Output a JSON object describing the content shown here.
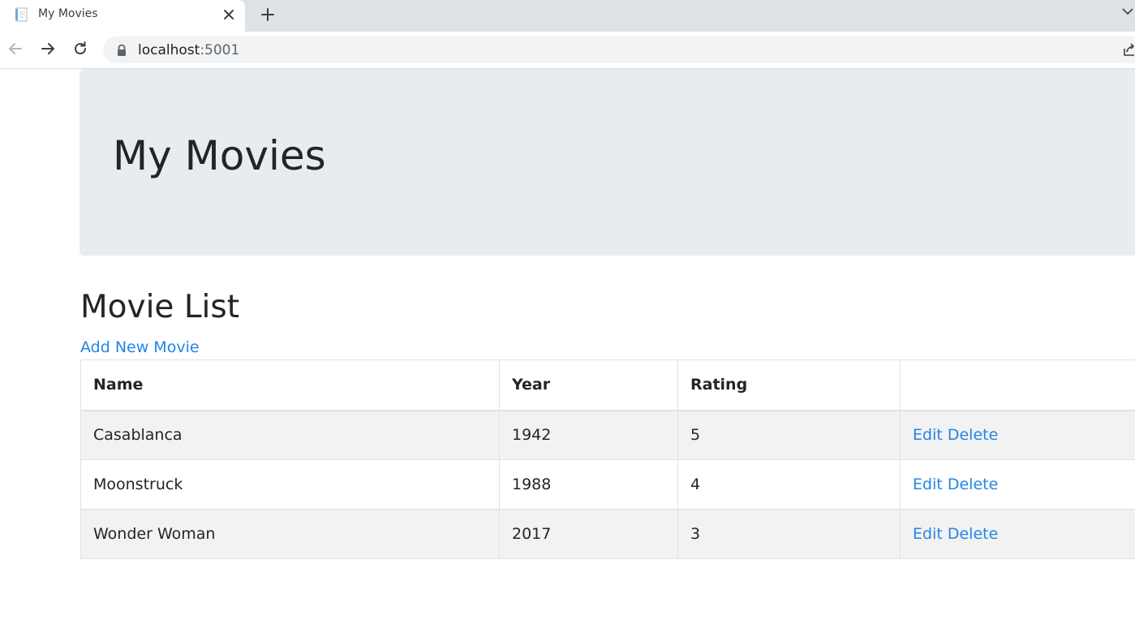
{
  "browser": {
    "tab_title": "My Movies",
    "url_host": "localhost",
    "url_port": ":5001"
  },
  "page": {
    "jumbotron_title": "My Movies",
    "section_title": "Movie List",
    "add_link": "Add New Movie"
  },
  "table": {
    "headers": [
      "Name",
      "Year",
      "Rating",
      ""
    ],
    "rows": [
      {
        "name": "Casablanca",
        "year": "1942",
        "rating": "5",
        "edit": "Edit",
        "delete": "Delete"
      },
      {
        "name": "Moonstruck",
        "year": "1988",
        "rating": "4",
        "edit": "Edit",
        "delete": "Delete"
      },
      {
        "name": "Wonder Woman",
        "year": "2017",
        "rating": "3",
        "edit": "Edit",
        "delete": "Delete"
      }
    ]
  },
  "icons": {
    "favicon": "document-icon",
    "close": "close-icon",
    "new_tab": "plus-icon",
    "back": "back-arrow-icon",
    "forward": "forward-arrow-icon",
    "reload": "reload-icon",
    "lock": "lock-icon",
    "share": "share-icon",
    "tab_menu": "chevron-down-icon"
  },
  "colors": {
    "link": "#2385e8",
    "jumbotron_bg": "#e9ecef",
    "stripe": "#f2f2f2"
  }
}
